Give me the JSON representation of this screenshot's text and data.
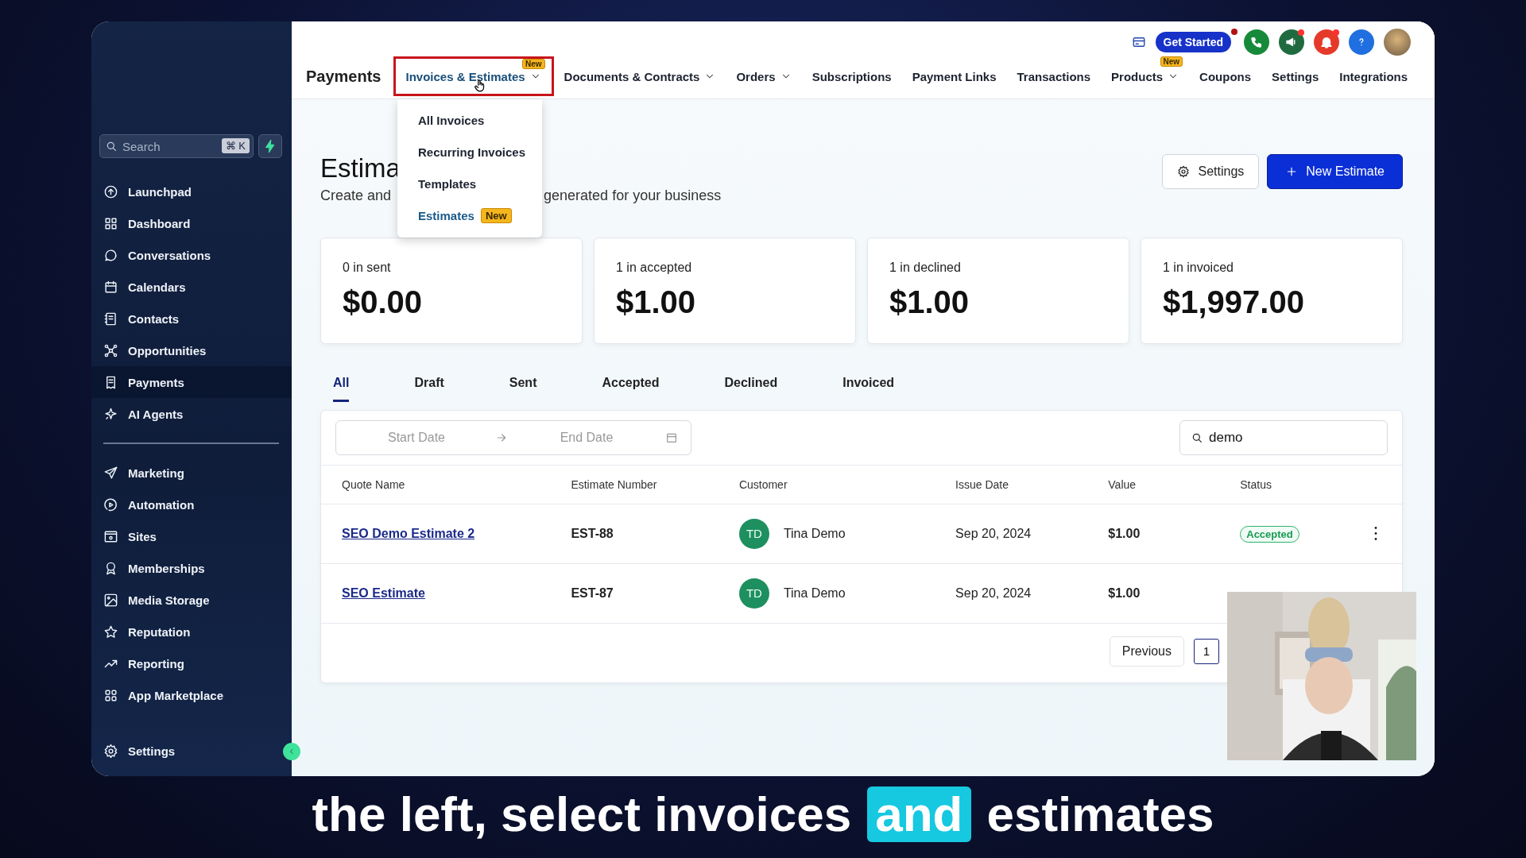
{
  "sidebar": {
    "search": {
      "placeholder": "Search",
      "shortcut": "⌘ K"
    },
    "items": [
      {
        "label": "Launchpad",
        "selected": false
      },
      {
        "label": "Dashboard",
        "selected": false
      },
      {
        "label": "Conversations",
        "selected": false
      },
      {
        "label": "Calendars",
        "selected": false
      },
      {
        "label": "Contacts",
        "selected": false
      },
      {
        "label": "Opportunities",
        "selected": false
      },
      {
        "label": "Payments",
        "selected": true
      },
      {
        "label": "AI Agents",
        "selected": false
      }
    ],
    "items_2": [
      {
        "label": "Marketing",
        "selected": false
      },
      {
        "label": "Automation",
        "selected": false
      },
      {
        "label": "Sites",
        "selected": false
      },
      {
        "label": "Memberships",
        "selected": false
      },
      {
        "label": "Media Storage",
        "selected": false
      },
      {
        "label": "Reputation",
        "selected": false
      },
      {
        "label": "Reporting",
        "selected": false
      },
      {
        "label": "App Marketplace",
        "selected": false
      }
    ],
    "footer_item": {
      "label": "Settings",
      "selected": false
    }
  },
  "header": {
    "title": "Payments",
    "get_started": "Get Started",
    "nav": [
      {
        "label": "Invoices & Estimates",
        "selected": true,
        "dropdown": true,
        "badge": "New",
        "highlighted": true
      },
      {
        "label": "Documents & Contracts",
        "selected": false,
        "dropdown": true,
        "highlighted": false
      },
      {
        "label": "Orders",
        "selected": false,
        "dropdown": true,
        "highlighted": false
      },
      {
        "label": "Subscriptions",
        "selected": false,
        "dropdown": false,
        "highlighted": false
      },
      {
        "label": "Payment Links",
        "selected": false,
        "dropdown": false,
        "highlighted": false
      },
      {
        "label": "Transactions",
        "selected": false,
        "dropdown": false,
        "highlighted": false
      },
      {
        "label": "Products",
        "selected": false,
        "dropdown": true,
        "badge": "New",
        "highlighted": false
      },
      {
        "label": "Coupons",
        "selected": false,
        "dropdown": false,
        "highlighted": false
      },
      {
        "label": "Settings",
        "selected": false,
        "dropdown": false,
        "highlighted": false
      },
      {
        "label": "Integrations",
        "selected": false,
        "dropdown": false,
        "highlighted": false
      }
    ],
    "menu": [
      {
        "label": "All Invoices",
        "selected": false
      },
      {
        "label": "Recurring Invoices",
        "selected": false
      },
      {
        "label": "Templates",
        "selected": false
      },
      {
        "label": "Estimates",
        "selected": true,
        "badge": "New"
      }
    ]
  },
  "page": {
    "title": "Estima",
    "subtitle_start": "Create and",
    "subtitle_end": "generated for your business",
    "buttons": [
      {
        "label": "Settings",
        "kind": "secondary"
      },
      {
        "label": "New Estimate",
        "kind": "primary"
      }
    ],
    "stats": [
      {
        "label": "0 in sent",
        "amount": "$0.00"
      },
      {
        "label": "1 in accepted",
        "amount": "$1.00"
      },
      {
        "label": "1 in declined",
        "amount": "$1.00"
      },
      {
        "label": "1 in invoiced",
        "amount": "$1,997.00"
      }
    ],
    "tabs": [
      {
        "label": "All",
        "selected": true
      },
      {
        "label": "Draft",
        "selected": false
      },
      {
        "label": "Sent",
        "selected": false
      },
      {
        "label": "Accepted",
        "selected": false
      },
      {
        "label": "Declined",
        "selected": false
      },
      {
        "label": "Invoiced",
        "selected": false
      }
    ],
    "date_range": {
      "start_placeholder": "Start Date",
      "end_placeholder": "End Date"
    },
    "search": {
      "value": "demo"
    },
    "table": {
      "columns": [
        "Quote Name",
        "Estimate Number",
        "Customer",
        "Issue Date",
        "Value",
        "Status"
      ],
      "rows": [
        {
          "quote": "SEO Demo Estimate 2",
          "number": "EST-88",
          "initials": "TD",
          "customer": "Tina Demo",
          "date": "Sep 20, 2024",
          "value": "$1.00",
          "status": "Accepted",
          "actions": true
        },
        {
          "quote": "SEO Estimate",
          "number": "EST-87",
          "initials": "TD",
          "customer": "Tina Demo",
          "date": "Sep 20, 2024",
          "value": "$1.00",
          "actions": false
        }
      ]
    },
    "pagination": {
      "previous": "Previous",
      "pages": [
        {
          "label": "1",
          "selected": true
        }
      ]
    }
  },
  "caption": [
    {
      "text": "the left, select invoices",
      "highlighted": false
    },
    {
      "text": "and",
      "highlighted": true
    },
    {
      "text": "estimates",
      "highlighted": false
    }
  ]
}
